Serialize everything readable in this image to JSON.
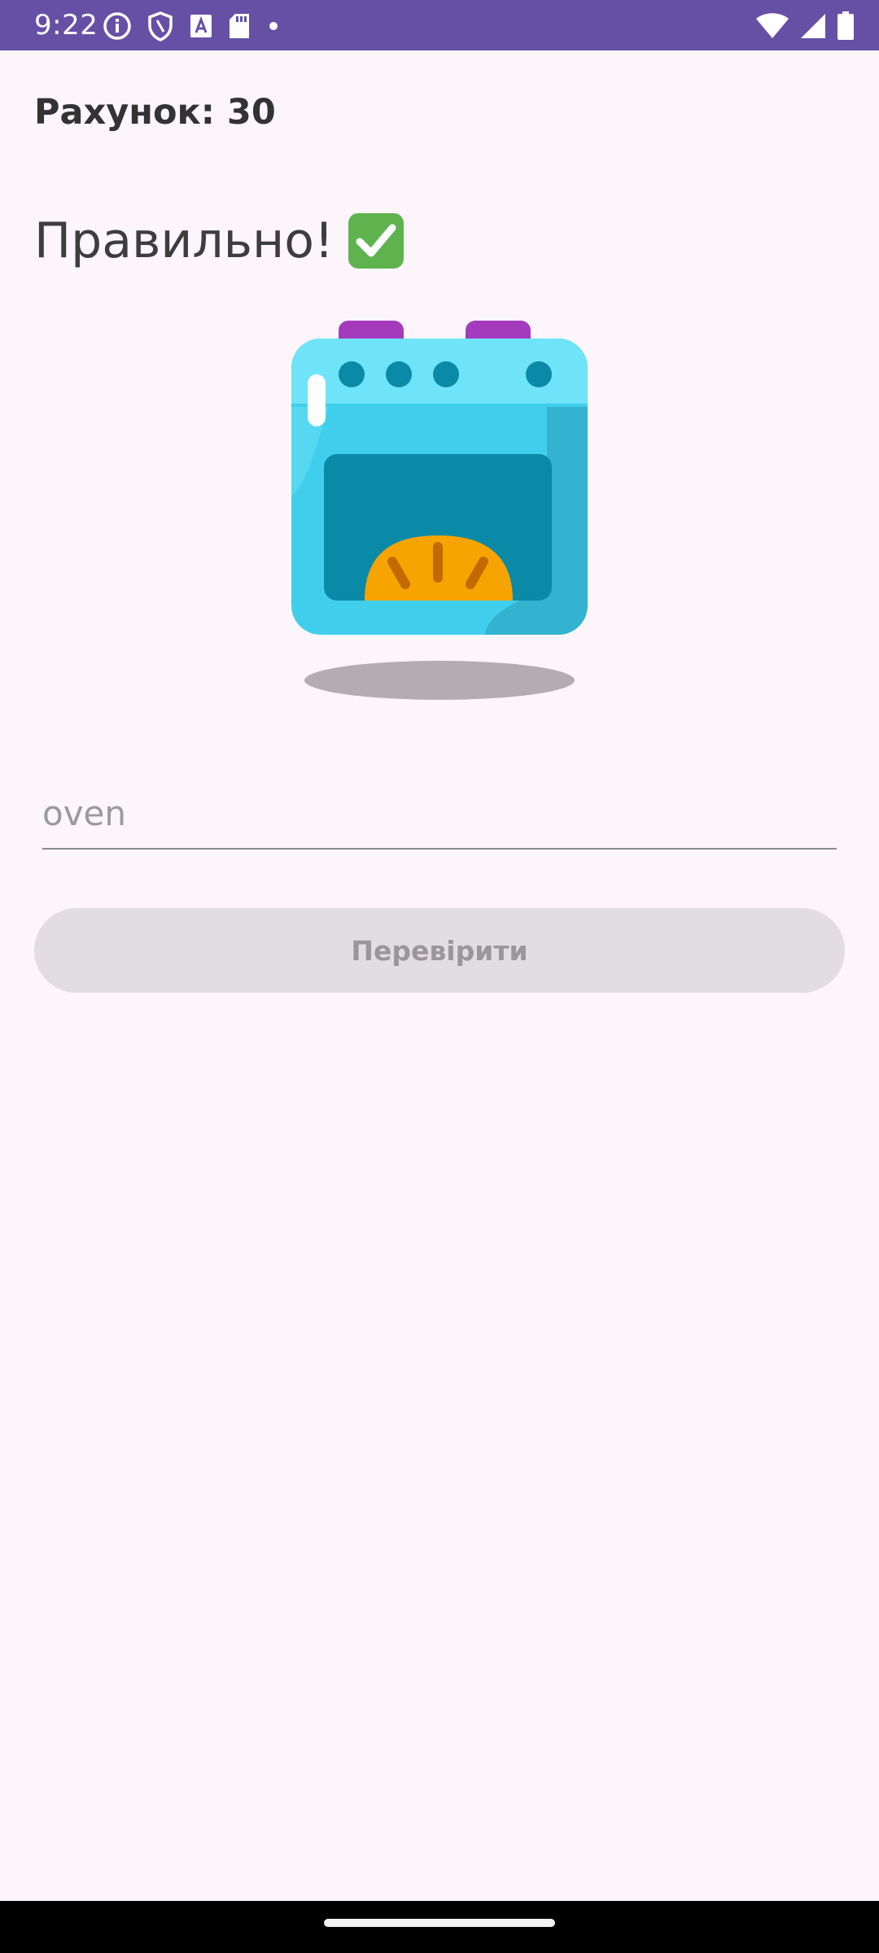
{
  "status_bar": {
    "time": "9:22",
    "left_icons": [
      "info-icon",
      "shield-icon",
      "font-a-icon",
      "sd-card-icon",
      "dot-icon"
    ],
    "right_icons": [
      "wifi-icon",
      "signal-icon",
      "battery-icon"
    ],
    "background": "#6650a5"
  },
  "score": {
    "label": "Рахунок: 30"
  },
  "feedback": {
    "text": "Правильно!",
    "icon": "check-mark-icon",
    "icon_color": "#5fb34e"
  },
  "illustration": {
    "name": "oven-with-bread-icon"
  },
  "answer": {
    "value": "oven"
  },
  "check_button": {
    "label": "Перевірити",
    "state": "disabled"
  },
  "colors": {
    "background": "#fcf6fc",
    "oven_body": "#3fcfec",
    "oven_window": "#0b8aa8",
    "knobs": "#a43bbd",
    "bread": "#f7a400"
  }
}
